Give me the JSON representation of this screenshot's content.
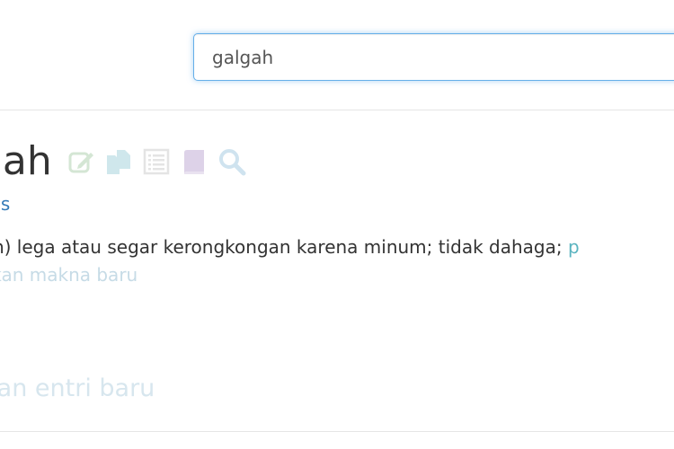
{
  "search": {
    "value": "galgah"
  },
  "entry": {
    "title": "gah",
    "label": "rus",
    "definition": "dah) lega atau segar kerongkongan karena minum; tidak dahaga;",
    "definition_link": "p",
    "suggest_meaning": "ulkan makna baru"
  },
  "suggest_entry": "lkan entri baru",
  "icons": {
    "edit": "edit-icon",
    "copy": "copy-icon",
    "list": "list-icon",
    "book": "book-icon",
    "search": "search-icon"
  },
  "colors": {
    "title": "#333333",
    "link": "#337ab7",
    "focus_border": "#66afe9",
    "faded_text": "#c6dbe6"
  }
}
